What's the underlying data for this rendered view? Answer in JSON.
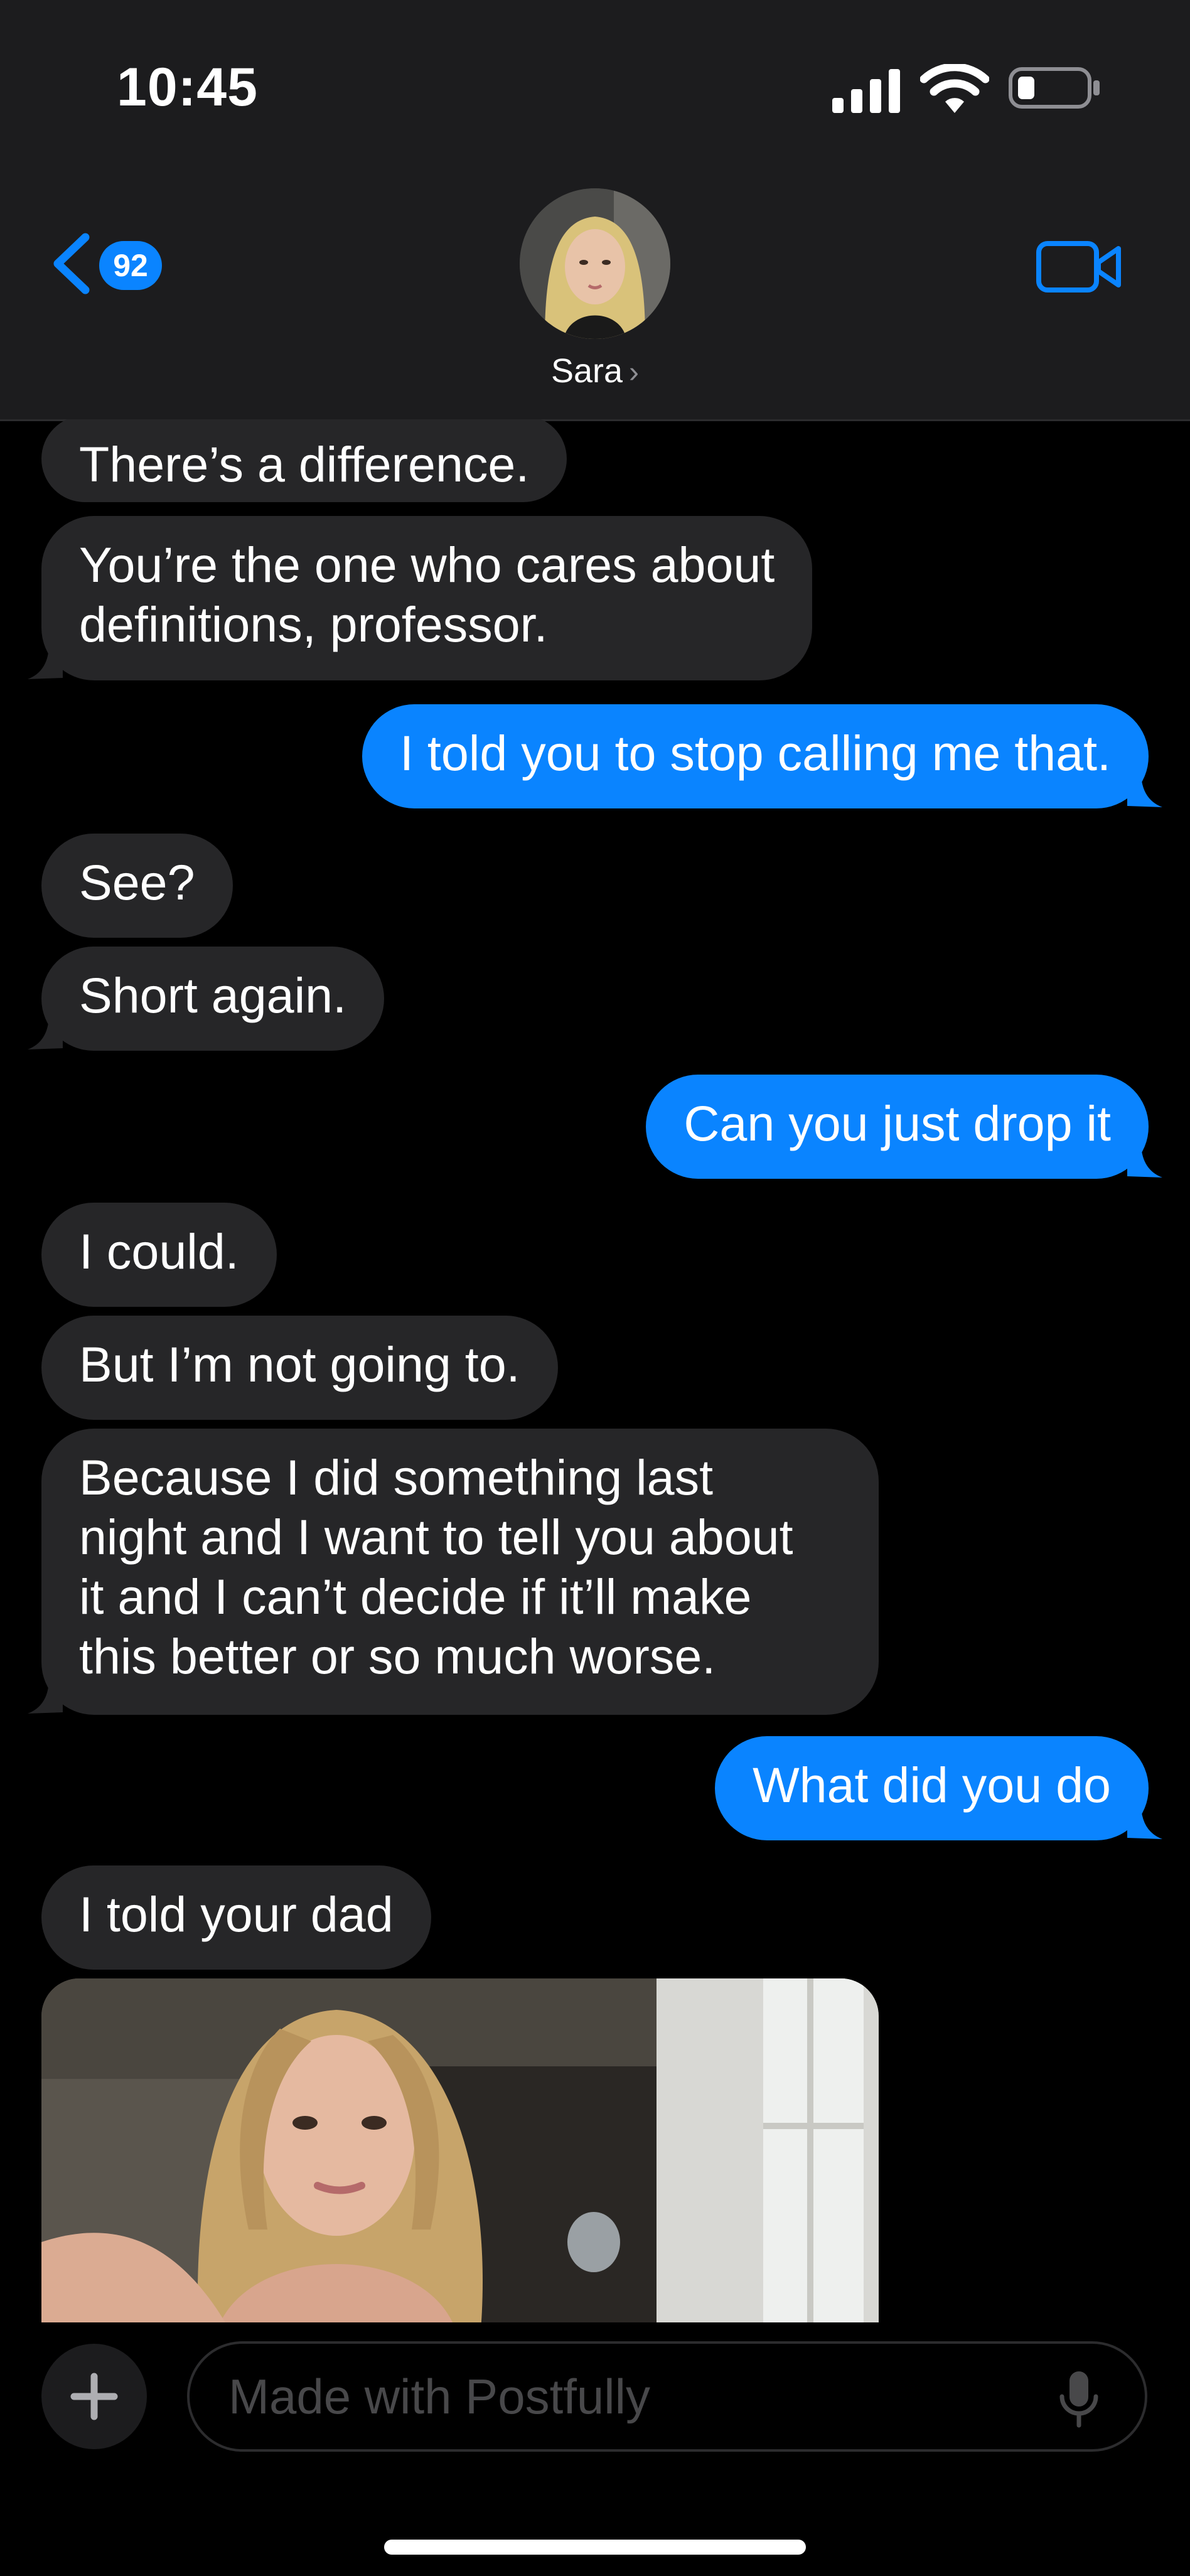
{
  "status_bar": {
    "time": "10:45"
  },
  "header": {
    "unread_count": "92",
    "contact_name": "Sara"
  },
  "messages": [
    {
      "sender": "them",
      "text": "There’s a difference."
    },
    {
      "sender": "them",
      "text": "You’re the one who cares about\ndefinitions, professor."
    },
    {
      "sender": "me",
      "text": "I told you to stop calling me that."
    },
    {
      "sender": "them",
      "text": "See?"
    },
    {
      "sender": "them",
      "text": "Short again."
    },
    {
      "sender": "me",
      "text": "Can you just drop it"
    },
    {
      "sender": "them",
      "text": "I could."
    },
    {
      "sender": "them",
      "text": "But I’m not going to."
    },
    {
      "sender": "them",
      "text": "Because I did something last\nnight and I want to tell you about\nit and I can’t decide if it’ll make\nthis better or so much worse."
    },
    {
      "sender": "me",
      "text": "What did you do"
    },
    {
      "sender": "them",
      "text": "I told your dad"
    }
  ],
  "composer": {
    "placeholder": "Made with Postfully"
  },
  "colors": {
    "accent": "#0a84ff",
    "incoming_bubble": "#262628",
    "header_bg": "#1c1c1e"
  },
  "icons": [
    "signal-icon",
    "wifi-icon",
    "battery-icon",
    "back-chevron-icon",
    "video-call-icon",
    "plus-icon",
    "microphone-icon"
  ]
}
